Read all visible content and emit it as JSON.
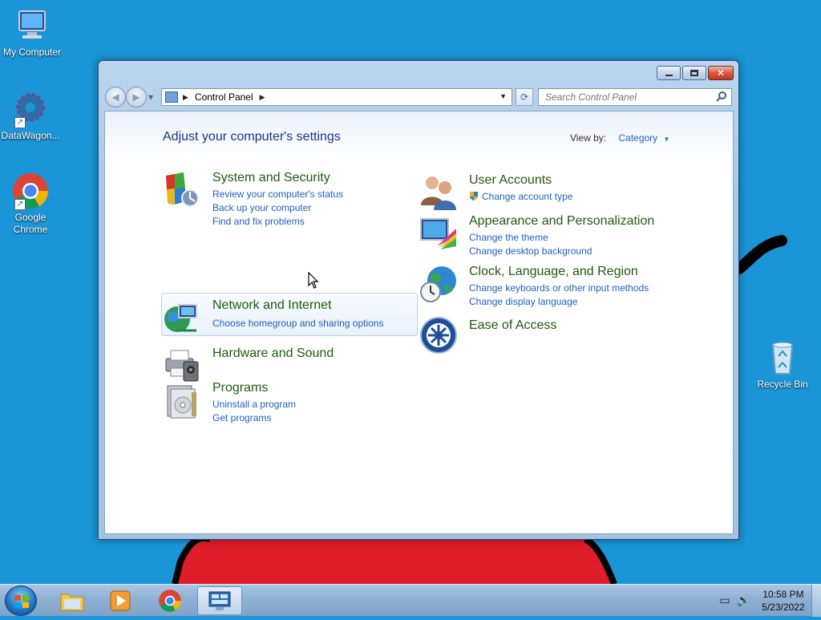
{
  "desktop": {
    "icons": [
      {
        "label": "My Computer"
      },
      {
        "label": "DataWagon..."
      },
      {
        "label": "Google Chrome"
      },
      {
        "label": "Recycle Bin"
      }
    ]
  },
  "window": {
    "address": {
      "crumb": "Control Panel"
    },
    "search": {
      "placeholder": "Search Control Panel"
    },
    "heading": "Adjust your computer's settings",
    "view_by": {
      "label": "View by:",
      "value": "Category"
    },
    "categories": [
      {
        "title": "System and Security",
        "links": [
          "Review your computer's status",
          "Back up your computer",
          "Find and fix problems"
        ]
      },
      {
        "title": "Network and Internet",
        "links": [
          "Choose homegroup and sharing options"
        ]
      },
      {
        "title": "Hardware and Sound",
        "links": []
      },
      {
        "title": "Programs",
        "links": [
          "Uninstall a program",
          "Get programs"
        ]
      },
      {
        "title": "User Accounts",
        "links": [
          "Change account type"
        ]
      },
      {
        "title": "Appearance and Personalization",
        "links": [
          "Change the theme",
          "Change desktop background"
        ]
      },
      {
        "title": "Clock, Language, and Region",
        "links": [
          "Change keyboards or other input methods",
          "Change display language"
        ]
      },
      {
        "title": "Ease of Access",
        "links": []
      }
    ]
  },
  "taskbar": {
    "clock": {
      "time": "10:58 PM",
      "date": "5/23/2022"
    }
  }
}
